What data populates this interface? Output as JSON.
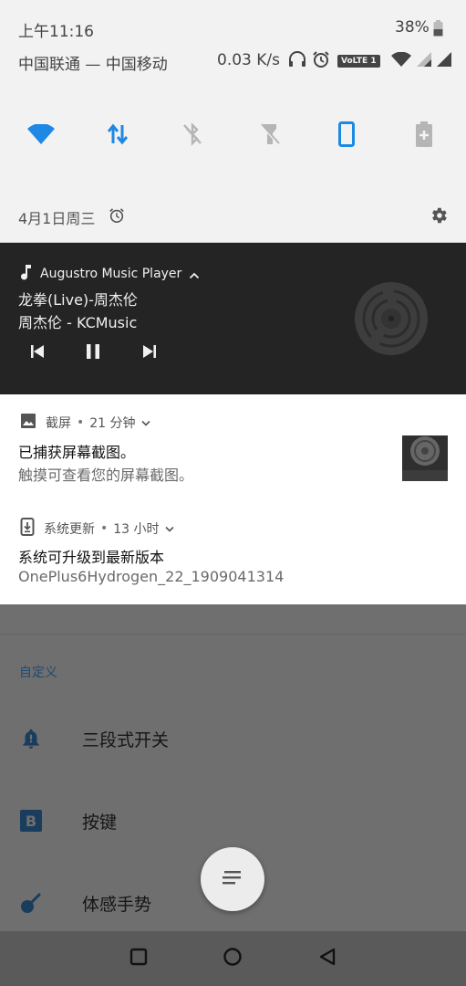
{
  "status_bar": {
    "time": "上午11:16",
    "battery": "38%",
    "carrier": "中国联通 — 中国移动",
    "net_speed": "0.03 K/s",
    "volte_badge": "VoLTE 1"
  },
  "quick_settings": [
    {
      "name": "wifi-icon",
      "active": true
    },
    {
      "name": "mobile-data-icon",
      "active": true
    },
    {
      "name": "bluetooth-off-icon",
      "active": false
    },
    {
      "name": "flashlight-off-icon",
      "active": false
    },
    {
      "name": "screen-rotation-icon",
      "active": true
    },
    {
      "name": "battery-saver-icon",
      "active": false
    }
  ],
  "date_line": "4月1日周三",
  "media": {
    "app_name": "Augustro Music Player",
    "title": "龙拳(Live)-周杰伦",
    "artist": "周杰伦 - KCMusic"
  },
  "notifications": [
    {
      "app": "截屏",
      "time": "21 分钟",
      "title": "已捕获屏幕截图。",
      "body": "触摸可查看您的屏幕截图。"
    },
    {
      "app": "系统更新",
      "time": "13 小时",
      "title": "系统可升级到最新版本",
      "body": "OnePlus6Hydrogen_22_1909041314"
    }
  ],
  "background_settings": {
    "section": "自定义",
    "items": [
      "三段式开关",
      "按键",
      "体感手势"
    ],
    "key_icon_letter": "B"
  },
  "colors": {
    "accent": "#1e88e5",
    "inactive": "#b5b5b5",
    "media_bg": "#242424"
  }
}
